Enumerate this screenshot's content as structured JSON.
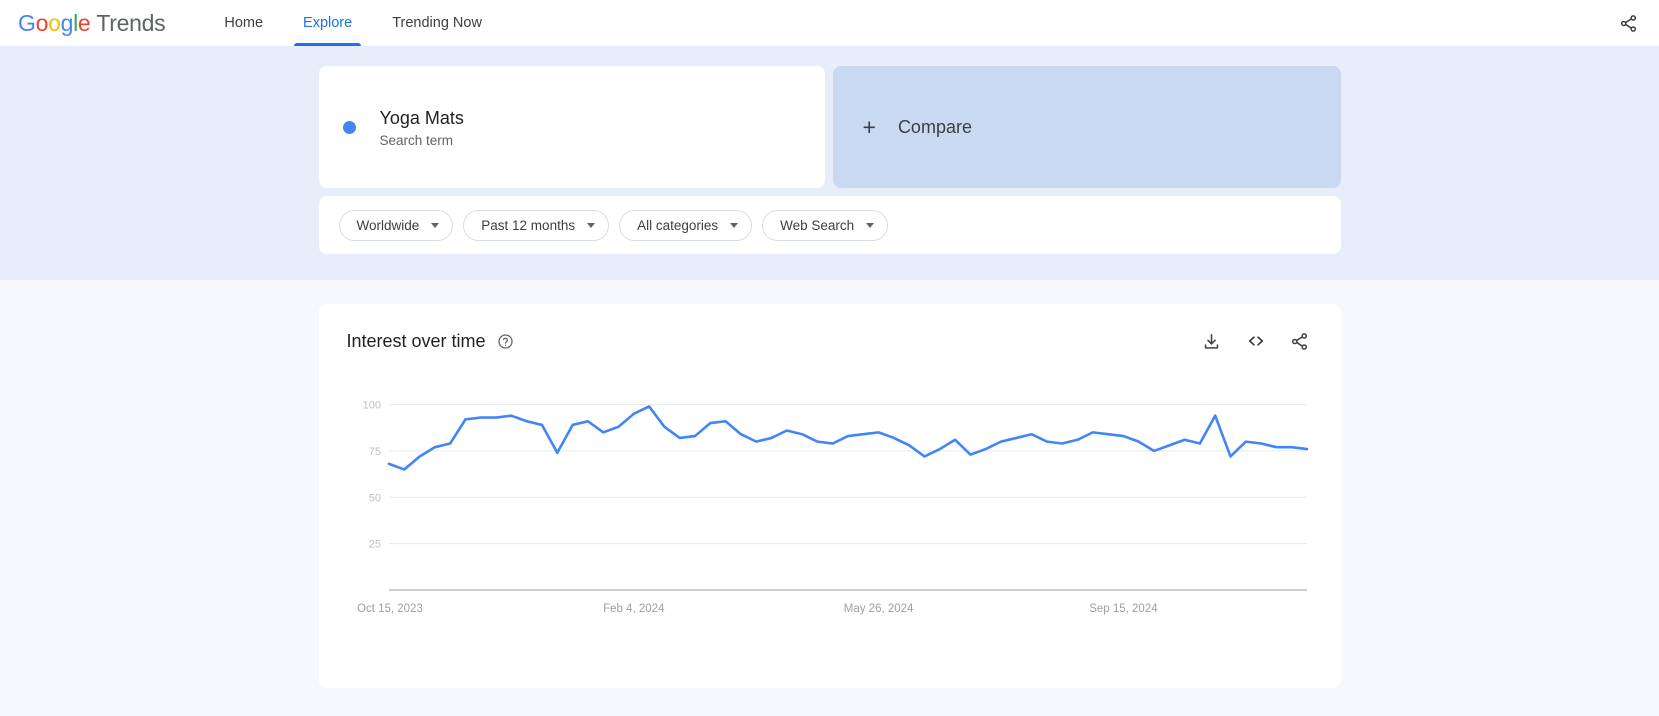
{
  "header": {
    "logo": {
      "word": "Google",
      "suffix": "Trends"
    },
    "nav": [
      {
        "label": "Home",
        "active": false
      },
      {
        "label": "Explore",
        "active": true
      },
      {
        "label": "Trending Now",
        "active": false
      }
    ],
    "share_icon": "share-icon"
  },
  "query": {
    "term": {
      "title": "Yoga Mats",
      "subtitle": "Search term",
      "color": "#4285F4"
    },
    "compare": {
      "label": "Compare",
      "plus": "+"
    }
  },
  "filters": [
    {
      "label": "Worldwide"
    },
    {
      "label": "Past 12 months"
    },
    {
      "label": "All categories"
    },
    {
      "label": "Web Search"
    }
  ],
  "chart_panel": {
    "title": "Interest over time",
    "help_icon": "help-circle-icon",
    "actions": [
      {
        "name": "download-icon"
      },
      {
        "name": "embed-code-icon"
      },
      {
        "name": "share-icon"
      }
    ]
  },
  "chart_data": {
    "type": "line",
    "title": "Interest over time",
    "xlabel": "",
    "ylabel": "",
    "ylim": [
      0,
      110
    ],
    "yticks": [
      100,
      75,
      50,
      25
    ],
    "grid": true,
    "legend": false,
    "line_color": "#4285F4",
    "x_tick_labels": [
      "Oct 15, 2023",
      "Feb 4, 2024",
      "May 26, 2024",
      "Sep 15, 2024"
    ],
    "x_tick_positions": [
      0,
      16,
      32,
      48
    ],
    "series": [
      {
        "name": "Yoga Mats",
        "values": [
          68,
          65,
          72,
          77,
          79,
          92,
          93,
          93,
          94,
          91,
          89,
          74,
          89,
          91,
          85,
          88,
          95,
          99,
          88,
          82,
          83,
          90,
          91,
          84,
          80,
          82,
          86,
          84,
          80,
          79,
          83,
          84,
          85,
          82,
          78,
          72,
          76,
          81,
          73,
          76,
          80,
          82,
          84,
          80,
          79,
          81,
          85,
          84,
          83,
          80,
          75,
          78,
          81,
          79,
          94,
          72,
          80,
          79,
          77,
          77,
          76
        ]
      }
    ]
  }
}
